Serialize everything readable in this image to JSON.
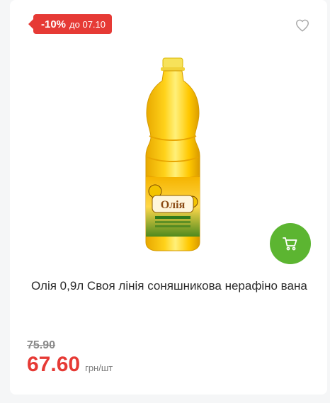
{
  "badge": {
    "percent": "-10%",
    "until": "до 07.10"
  },
  "product": {
    "image_label": "Олія",
    "title": "Олія 0,9л Своя лінія соняшникова нерафіно вана"
  },
  "price": {
    "old": "75.90",
    "current": "67.60",
    "unit": "грн/шт"
  },
  "icons": {
    "favorite": "heart-outline-icon",
    "cart": "shopping-cart-icon"
  },
  "colors": {
    "badge": "#e63a35",
    "cart_button": "#5cb531",
    "price": "#e63a35"
  }
}
